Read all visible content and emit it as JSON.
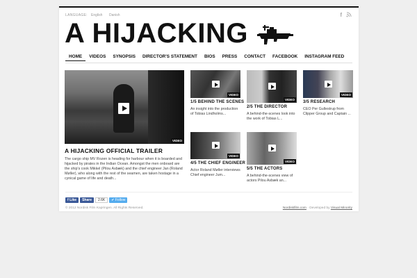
{
  "topbar": {
    "language_label": "LANGUAGE:",
    "languages": [
      "English",
      "Danish"
    ]
  },
  "social": {
    "facebook": "f",
    "rss": "◔"
  },
  "site_title": "A HIJACKING",
  "nav": [
    "HOME",
    "VIDEOS",
    "SYNOPSIS",
    "DIRECTOR'S STATEMENT",
    "BIOS",
    "PRESS",
    "CONTACT",
    "FACEBOOK",
    "INSTAGRAM FEED"
  ],
  "video_badge": "VIDEO",
  "featured": {
    "title": "A HIJACKING OFFICIAL TRAILER",
    "desc": "The cargo ship MV Rozen is heading for harbour when it is boarded and hijacked by pirates in the Indian Ocean. Amongst the men onboard are the ship's cook Mikkel (Pilou Asbæk) and the chief engineer Jan (Roland Møller), who along with the rest of the seamen, are taken hostage in a cynical game of life and death..."
  },
  "cards": [
    {
      "title": "1/5 BEHIND THE SCENES",
      "desc": "An insight into the production of Tobias Lindholms..."
    },
    {
      "title": "2/5 THE DIRECTOR",
      "desc": "A behind-the-scenes look into the work of Tobias L..."
    },
    {
      "title": "3/5 RESEARCH",
      "desc": "CEO Per Gullestrup from Clipper Group and Captain ..."
    },
    {
      "title": "4/5 THE CHIEF ENGINEER",
      "desc": "Actor Roland Møller interviews Chief engineer Jum..."
    },
    {
      "title": "5/5 THE ACTORS",
      "desc": "A behind-the-scenes view of actors Pilou Asbæk an..."
    }
  ],
  "social_buttons": {
    "like": "Like",
    "share": "Share",
    "count": "2.6K",
    "follow": "Follow"
  },
  "footer": {
    "copyright": "© 2012 Nordisk Film Kapringen. All Rights Reserved.",
    "site_link": "Nordiskfilm.com",
    "developed_by": "· Developed by",
    "dev_link": "Visual Minority"
  }
}
